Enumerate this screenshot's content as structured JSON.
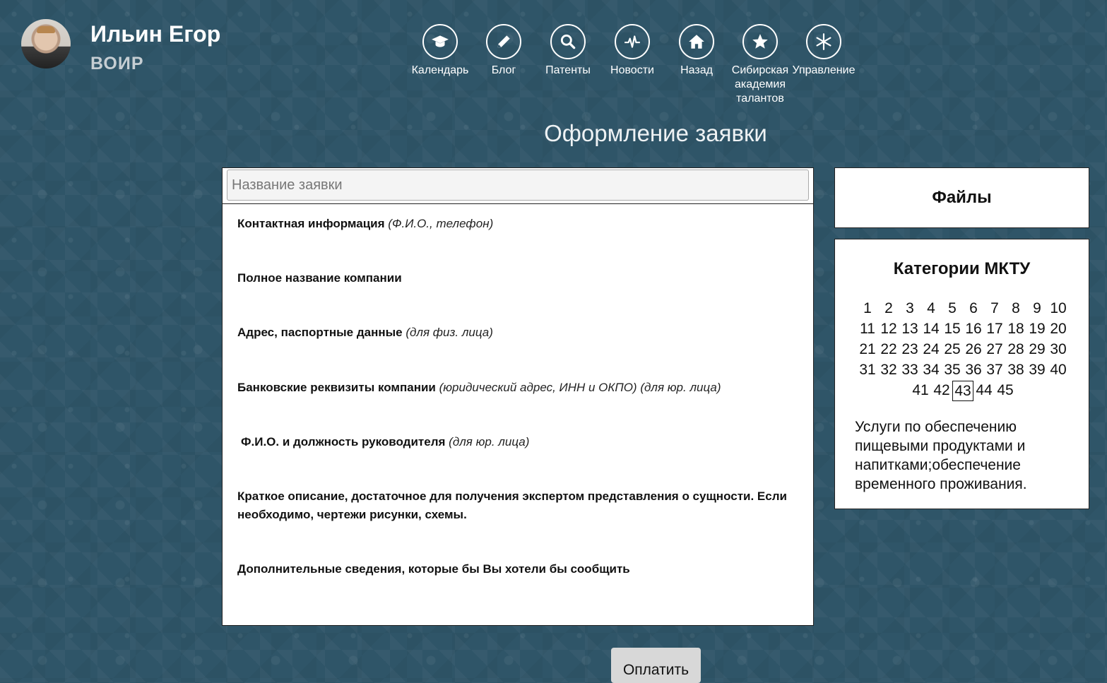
{
  "profile": {
    "name": "Ильин Егор",
    "org": "ВОИР"
  },
  "nav": [
    {
      "label": "Календарь",
      "icon": "graduation-cap-icon"
    },
    {
      "label": "Блог",
      "icon": "pencil-icon"
    },
    {
      "label": "Патенты",
      "icon": "search-icon"
    },
    {
      "label": "Новости",
      "icon": "pulse-icon"
    },
    {
      "label": "Назад",
      "icon": "home-icon"
    },
    {
      "label": "Сибирская академия талантов",
      "icon": "star-icon"
    },
    {
      "label": "Управление",
      "icon": "asterisk-icon"
    }
  ],
  "page_title": "Оформление заявки",
  "form": {
    "title_placeholder": "Название заявки",
    "fields": [
      {
        "label": "Контактная информация",
        "hint": "(Ф.И.О., телефон)"
      },
      {
        "label": "Полное название компании",
        "hint": ""
      },
      {
        "label": "Адрес, паспортные данные",
        "hint": "(для физ. лица)"
      },
      {
        "label": "Банковские реквизиты компании",
        "hint": "(юридический адрес, ИНН и ОКПО) (для юр. лица)"
      },
      {
        "label": "Ф.И.О. и должность руководителя",
        "hint": "(для юр. лица)"
      },
      {
        "label": "Краткое описание, достаточное для получения экспертом представления о сущности. Если необходимо, чертежи рисунки, схемы.",
        "hint": ""
      },
      {
        "label": "Дополнительные сведения, которые бы Вы хотели бы сообщить",
        "hint": ""
      }
    ]
  },
  "files": {
    "title": "Файлы"
  },
  "mktu": {
    "title": "Категории МКТУ",
    "categories": [
      "1",
      "2",
      "3",
      "4",
      "5",
      "6",
      "7",
      "8",
      "9",
      "10",
      "11",
      "12",
      "13",
      "14",
      "15",
      "16",
      "17",
      "18",
      "19",
      "20",
      "21",
      "22",
      "23",
      "24",
      "25",
      "26",
      "27",
      "28",
      "29",
      "30",
      "31",
      "32",
      "33",
      "34",
      "35",
      "36",
      "37",
      "38",
      "39",
      "40",
      "41",
      "42",
      "43",
      "44",
      "45"
    ],
    "selected": "43",
    "description": "Услуги по обеспечению пищевыми продуктами и напитками;обеспечение временного проживания."
  },
  "pay_button": "Оплатить"
}
